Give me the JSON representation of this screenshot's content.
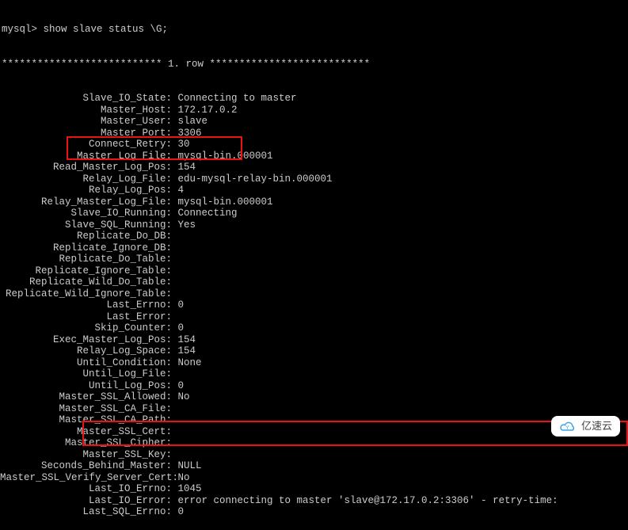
{
  "prompt": "mysql> show slave status \\G;",
  "header": "*************************** 1. row ***************************",
  "fields": [
    {
      "label": "Slave_IO_State",
      "value": "Connecting to master"
    },
    {
      "label": "Master_Host",
      "value": "172.17.0.2"
    },
    {
      "label": "Master_User",
      "value": "slave"
    },
    {
      "label": "Master_Port",
      "value": "3306"
    },
    {
      "label": "Connect_Retry",
      "value": "30"
    },
    {
      "label": "Master_Log_File",
      "value": "mysql-bin.000001"
    },
    {
      "label": "Read_Master_Log_Pos",
      "value": "154"
    },
    {
      "label": "Relay_Log_File",
      "value": "edu-mysql-relay-bin.000001"
    },
    {
      "label": "Relay_Log_Pos",
      "value": "4"
    },
    {
      "label": "Relay_Master_Log_File",
      "value": "mysql-bin.000001"
    },
    {
      "label": "Slave_IO_Running",
      "value": "Connecting"
    },
    {
      "label": "Slave_SQL_Running",
      "value": "Yes"
    },
    {
      "label": "Replicate_Do_DB",
      "value": ""
    },
    {
      "label": "Replicate_Ignore_DB",
      "value": ""
    },
    {
      "label": "Replicate_Do_Table",
      "value": ""
    },
    {
      "label": "Replicate_Ignore_Table",
      "value": ""
    },
    {
      "label": "Replicate_Wild_Do_Table",
      "value": ""
    },
    {
      "label": "Replicate_Wild_Ignore_Table",
      "value": ""
    },
    {
      "label": "Last_Errno",
      "value": "0"
    },
    {
      "label": "Last_Error",
      "value": ""
    },
    {
      "label": "Skip_Counter",
      "value": "0"
    },
    {
      "label": "Exec_Master_Log_Pos",
      "value": "154"
    },
    {
      "label": "Relay_Log_Space",
      "value": "154"
    },
    {
      "label": "Until_Condition",
      "value": "None"
    },
    {
      "label": "Until_Log_File",
      "value": ""
    },
    {
      "label": "Until_Log_Pos",
      "value": "0"
    },
    {
      "label": "Master_SSL_Allowed",
      "value": "No"
    },
    {
      "label": "Master_SSL_CA_File",
      "value": ""
    },
    {
      "label": "Master_SSL_CA_Path",
      "value": ""
    },
    {
      "label": "Master_SSL_Cert",
      "value": ""
    },
    {
      "label": "Master_SSL_Cipher",
      "value": ""
    },
    {
      "label": "Master_SSL_Key",
      "value": ""
    },
    {
      "label": "Seconds_Behind_Master",
      "value": "NULL"
    },
    {
      "label": "Master_SSL_Verify_Server_Cert",
      "value": "No"
    },
    {
      "label": "Last_IO_Errno",
      "value": "1045"
    },
    {
      "label": "Last_IO_Error",
      "value": "error connecting to master 'slave@172.17.0.2:3306' - retry-time:"
    },
    {
      "label": "Last_SQL_Errno",
      "value": "0"
    }
  ],
  "watermark": "亿速云"
}
